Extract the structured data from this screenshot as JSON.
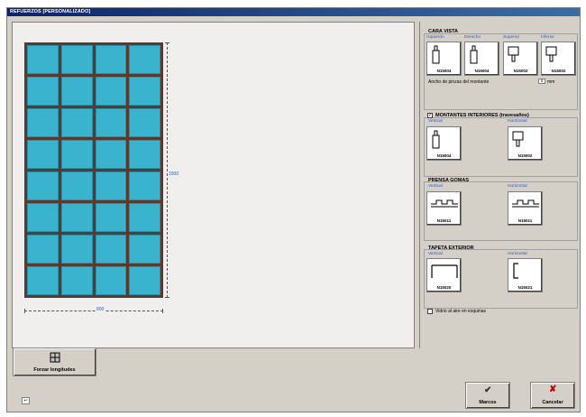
{
  "window": {
    "title": "REFUERZOS [PERSONALIZADO]"
  },
  "canvas": {
    "height_label": "1500",
    "width_label": "800"
  },
  "cara_vista": {
    "title": "CARA VISTA",
    "labels": [
      "Izquierdo",
      "Derecho",
      "Superior",
      "Inferior"
    ],
    "codes": [
      "N15004",
      "N15004",
      "N15002",
      "N15002"
    ],
    "width_text": "Ancho de pinzas del montante",
    "width_value": "0",
    "width_unit": "mm"
  },
  "montantes": {
    "checkbox_mark": "✓",
    "title": "MONTANTES INTERIORES (travesaños)",
    "labels": [
      "Vertical",
      "Horizontal"
    ],
    "codes": [
      "N15004",
      "N15002"
    ]
  },
  "prensa_gomas": {
    "title": "PRENSA GOMAS",
    "labels": [
      "Vertical",
      "Horizontal"
    ],
    "codes": [
      "N15011",
      "N15011"
    ]
  },
  "tapeta": {
    "title": "TAPETA EXTERIOR",
    "labels": [
      "Vertical",
      "Horizontal"
    ],
    "codes": [
      "N15020",
      "N15021"
    ]
  },
  "footer_check": {
    "label": "Vidrio al aire en esquinas"
  },
  "buttons": {
    "forzar": "Forzar longitudes",
    "aceptar": "Marcos",
    "cancelar": "Cancelar"
  },
  "corner": {
    "label": "↩"
  }
}
